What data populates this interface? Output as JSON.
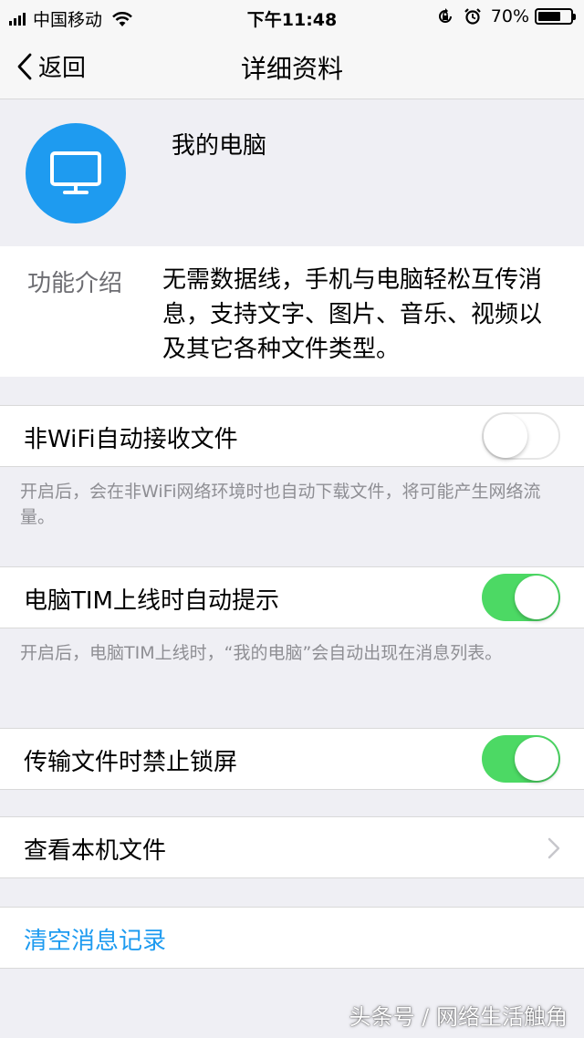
{
  "status_bar": {
    "carrier": "中国移动",
    "time": "下午11:48",
    "battery_percent": "70%",
    "battery_level": 0.7,
    "icons": [
      "signal-icon",
      "wifi-icon",
      "orientation-lock-icon",
      "alarm-icon",
      "battery-icon"
    ]
  },
  "nav": {
    "back_label": "返回",
    "title": "详细资料"
  },
  "profile": {
    "name": "我的电脑",
    "avatar_icon": "monitor-icon",
    "avatar_color": "#1e9bf0"
  },
  "intro": {
    "label": "功能介绍",
    "text": "无需数据线，手机与电脑轻松互传消息，支持文字、图片、音乐、视频以及其它各种文件类型。"
  },
  "settings": {
    "wifi_receive": {
      "label": "非WiFi自动接收文件",
      "enabled": false,
      "description": "开启后，会在非WiFi网络环境时也自动下载文件，将可能产生网络流量。"
    },
    "tim_online": {
      "label": "电脑TIM上线时自动提示",
      "enabled": true,
      "description": "开启后，电脑TIM上线时，“我的电脑”会自动出现在消息列表。"
    },
    "no_lock": {
      "label": "传输文件时禁止锁屏",
      "enabled": true
    }
  },
  "view_files": {
    "label": "查看本机文件"
  },
  "clear_history": {
    "label": "清空消息记录"
  },
  "watermark": "头条号 / 网络生活触角",
  "colors": {
    "accent": "#1e9bf0",
    "toggle_on": "#4cd964",
    "background": "#efeff4"
  }
}
